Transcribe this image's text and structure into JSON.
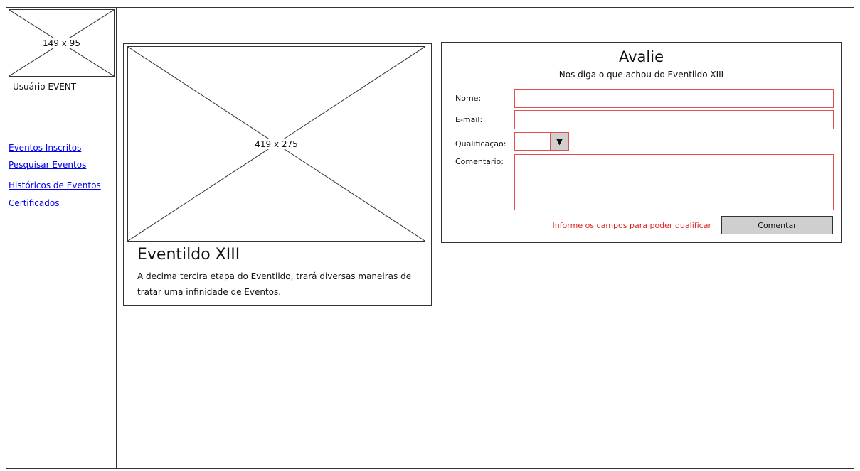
{
  "sidebar": {
    "avatar_placeholder": "149 x 95",
    "username": "Usuário EVENT",
    "links": [
      {
        "label": "Eventos Inscritos"
      },
      {
        "label": "Pesquisar Eventos"
      },
      {
        "label": "Históricos de Eventos"
      },
      {
        "label": "Certificados"
      }
    ]
  },
  "event": {
    "image_placeholder": "419 x 275",
    "title": "Eventildo XIII",
    "description": "A decima tercira etapa do Eventildo, trará diversas maneiras de tratar uma infinidade de Eventos."
  },
  "review": {
    "title": "Avalie",
    "subtitle": "Nos diga o que achou do Eventildo XIII",
    "name_label": "Nome:",
    "email_label": "E-mail:",
    "rating_label": "Qualificação:",
    "rating_value": "",
    "comment_label": "Comentario:",
    "error_message": "Informe os campos para poder qualificar",
    "submit_label": "Comentar",
    "field_border_color": "#e05050",
    "error_color": "#e02020"
  }
}
